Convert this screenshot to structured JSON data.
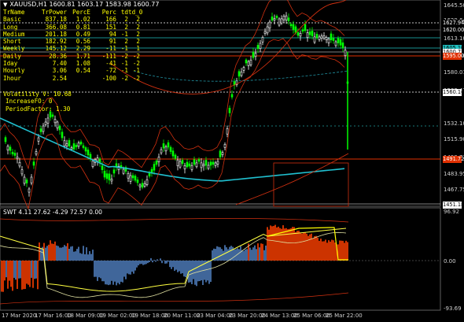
{
  "header": {
    "symbol": "XAUUSD,H1",
    "ohlc": "1600.81 1603.17 1583.98 1600.77"
  },
  "stats": {
    "columns": [
      "TrName",
      "TrPower",
      "PercE",
      "Perc",
      "td",
      "td_0"
    ],
    "rows": [
      [
        "Basic",
        "837.18",
        "1.02",
        "166",
        "2",
        "2"
      ],
      [
        "Long",
        "366.08",
        "0.81",
        "151",
        "2",
        "2"
      ],
      [
        "Medium",
        "201.18",
        "0.49",
        "94",
        "-1",
        "2"
      ],
      [
        "Short",
        "182.92",
        "0.56",
        "91",
        "2",
        "2"
      ],
      [
        "Weekly",
        "145.12",
        "2.29",
        "-11",
        "-1",
        "1"
      ],
      [
        "Daily",
        "28.36",
        "1.71",
        "-111",
        "-2",
        "-2"
      ],
      [
        "Iday",
        "7.40",
        "1.08",
        "-41",
        "-1",
        "-2"
      ],
      [
        "Hourly",
        "3.06",
        "0.54",
        "-72",
        "-1",
        "-1"
      ],
      [
        "Ihour",
        "2.54",
        "",
        "-100",
        "-2",
        "-2"
      ]
    ]
  },
  "volatility": {
    "volatility_line": "Volatility V: 10.68",
    "increase_line": "IncreaseFO: 0",
    "period_line": "PeriodFactor: 1.30"
  },
  "price_axis": [
    "1645.50",
    "1629.64",
    "1613.10",
    "1596.56",
    "1580.01",
    "1563.47",
    "1532.10",
    "1515.90",
    "1499.71",
    "1483.95",
    "1467.75"
  ],
  "price_boxes": [
    {
      "label": "1627.94",
      "bg": "#000000",
      "fg": "#ffffff"
    },
    {
      "label": "1620.00",
      "bg": "#000000",
      "fg": "#ffffff"
    },
    {
      "label": "1605.10",
      "bg": "#20c0c0",
      "fg": "#000000"
    },
    {
      "label": "1600.77",
      "bg": "#ffffff",
      "fg": "#000000"
    },
    {
      "label": "1595.00",
      "bg": "#e03000",
      "fg": "#ffffff"
    },
    {
      "label": "1560.16",
      "bg": "#ffffff",
      "fg": "#000000"
    },
    {
      "label": "1491.72",
      "bg": "#e03000",
      "fg": "#ffffff"
    },
    {
      "label": "1451.18",
      "bg": "#ffffff",
      "fg": "#000000"
    }
  ],
  "indicator": {
    "header": "SWT 4.11 27.62 -4.29 72.57 0.00",
    "axis": [
      "96.92",
      "0.00",
      "-93.69"
    ]
  },
  "time_axis": [
    "17 Mar 2020",
    "17 Mar 16:00",
    "18 Mar 09:00",
    "19 Mar 02:00",
    "19 Mar 18:00",
    "20 Mar 11:00",
    "23 Mar 04:00",
    "23 Mar 20:00",
    "24 Mar 13:00",
    "25 Mar 06:00",
    "25 Mar 22:00"
  ],
  "colors": {
    "bull": "#00ff00",
    "ma_cyan": "#20c0d0",
    "envelope": "#d03010",
    "stats_text": "#ffff00",
    "hist_red": "#ff4000",
    "hist_blue": "#5080c0"
  }
}
